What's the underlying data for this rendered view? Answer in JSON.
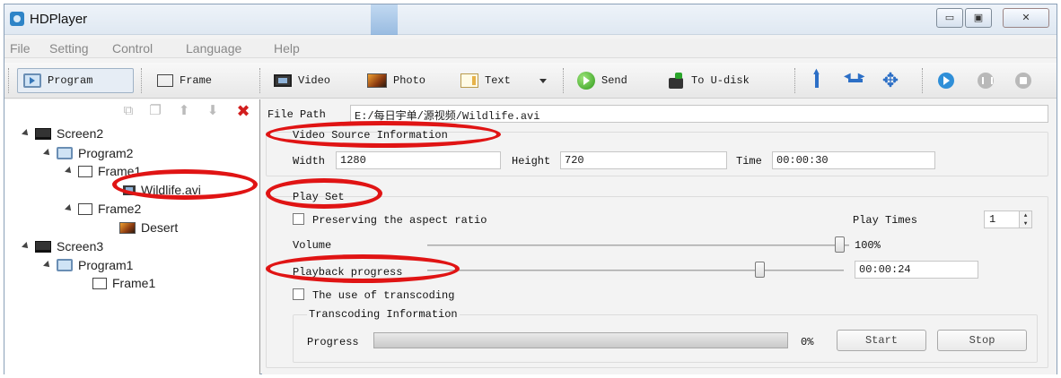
{
  "window": {
    "title": "HDPlayer"
  },
  "menu": [
    "File",
    "Setting",
    "Control",
    "Language",
    "Help"
  ],
  "toolbar": {
    "program": "Program",
    "frame": "Frame",
    "video": "Video",
    "photo": "Photo",
    "text": "Text",
    "send": "Send",
    "to_udisk": "To U-disk"
  },
  "tree": {
    "nodes": [
      {
        "label": "Screen2"
      },
      {
        "label": "Program2"
      },
      {
        "label": "Frame1"
      },
      {
        "label": "Wildlife.avi"
      },
      {
        "label": "Frame2"
      },
      {
        "label": "Desert"
      },
      {
        "label": "Screen3"
      },
      {
        "label": "Program1"
      },
      {
        "label": "Frame1"
      }
    ]
  },
  "props": {
    "file_path_label": "File Path",
    "file_path_value": "E:/每日宇单/源视频/Wildlife.avi",
    "video_source_title": "Video Source Information",
    "width_label": "Width",
    "width_value": "1280",
    "height_label": "Height",
    "height_value": "720",
    "time_label": "Time",
    "time_value": "00:00:30",
    "play_set_title": "Play Set",
    "preserve_label": "Preserving the aspect ratio",
    "play_times_label": "Play Times",
    "play_times_value": "1",
    "volume_label": "Volume",
    "volume_value": "100%",
    "volume_level": 1.0,
    "playback_label": "Playback progress",
    "playback_time": "00:00:24",
    "playback_level": 0.8,
    "transcoding_label": "The use of transcoding",
    "transcoding_info_title": "Transcoding Information",
    "progress_label": "Progress",
    "progress_value": "0%",
    "start_label": "Start",
    "stop_label": "Stop"
  },
  "colors": {
    "annotation": "#e01414",
    "accent": "#2c6fc6"
  }
}
